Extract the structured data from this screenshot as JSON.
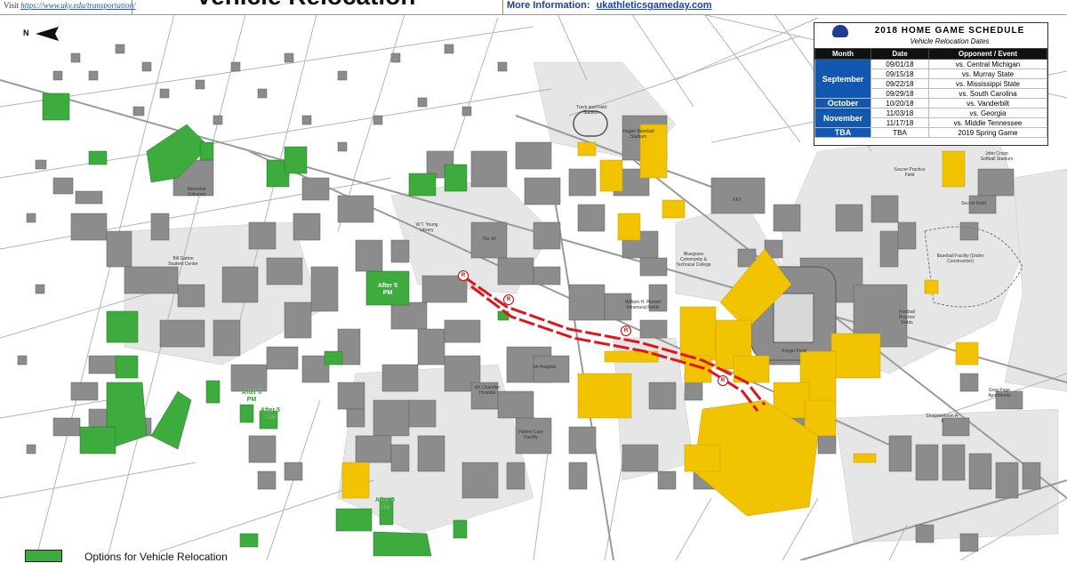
{
  "header": {
    "visit_prefix": "Visit",
    "visit_url": "https://www.uky.edu/transportation/",
    "title": "Vehicle Relocation",
    "more_info_label": "More Information:",
    "more_info_link": "ukathleticsgameday.com"
  },
  "compass": {
    "north_label": "N"
  },
  "schedule": {
    "title": "2018 HOME GAME SCHEDULE",
    "subtitle": "Vehicle Relocation Dates",
    "columns": [
      "Month",
      "Date",
      "Opponent / Event"
    ],
    "groups": [
      {
        "month": "September",
        "rows": [
          {
            "date": "09/01/18",
            "opponent": "vs. Central Michigan"
          },
          {
            "date": "09/15/18",
            "opponent": "vs. Murray State"
          },
          {
            "date": "09/22/18",
            "opponent": "vs. Mississippi State"
          },
          {
            "date": "09/29/18",
            "opponent": "vs. South Carolina"
          }
        ]
      },
      {
        "month": "October",
        "rows": [
          {
            "date": "10/20/18",
            "opponent": "vs. Vanderbilt"
          }
        ]
      },
      {
        "month": "November",
        "rows": [
          {
            "date": "11/03/18",
            "opponent": "vs. Georgia"
          },
          {
            "date": "11/17/18",
            "opponent": "vs. Middle Tennessee"
          }
        ]
      },
      {
        "month": "TBA",
        "rows": [
          {
            "date": "TBA",
            "opponent": "2019 Spring Game"
          }
        ]
      }
    ]
  },
  "legend": {
    "label": "Options for Vehicle Relocation"
  },
  "after_labels": [
    "After 5 PM",
    "After 5 PM",
    "After 5 PM",
    "After 5 PM"
  ],
  "restriction_marker": "R",
  "place_labels": [
    "Track and Field Stadium",
    "Hagan Baseball Stadium",
    "Soccer Practice Field",
    "John Cropp Softball Stadium",
    "Soccer Field",
    "KET",
    "Baseball Facility (Under Construction)",
    "Bluegrass Community & Technical College",
    "William H. Pierrett Intramural Fields",
    "Kroger Field",
    "Football Practice Fields",
    "Greg Page Apartments",
    "Shawneetown A-F",
    "W.T. Young Library",
    "The 90",
    "Memorial Coliseum",
    "Bill Gatton Student Center",
    "UK Chandler Hospital",
    "VA Hospital",
    "Patient Care Facility",
    "Commonwealth Stadium"
  ],
  "colors": {
    "relocation_green": "#3eab3e",
    "restricted_yellow": "#f2c300",
    "restriction_red": "#e0141b",
    "building_gray": "#8c8c8c",
    "month_blue": "#1358b0"
  }
}
